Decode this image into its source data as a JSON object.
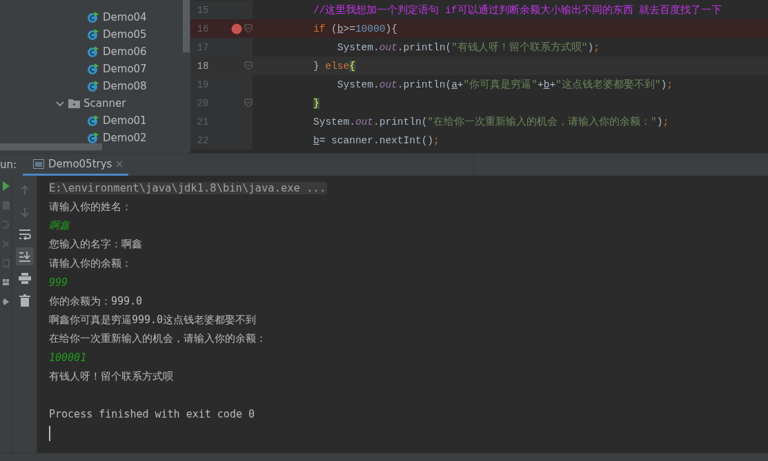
{
  "project_tree": [
    {
      "label": "Demo04",
      "kind": "class"
    },
    {
      "label": "Demo05",
      "kind": "class"
    },
    {
      "label": "Demo06",
      "kind": "class"
    },
    {
      "label": "Demo07",
      "kind": "class"
    },
    {
      "label": "Demo08",
      "kind": "class"
    },
    {
      "label": "Scanner",
      "kind": "package",
      "expanded": true,
      "children": [
        {
          "label": "Demo01",
          "kind": "class"
        },
        {
          "label": "Demo02",
          "kind": "class"
        }
      ]
    }
  ],
  "editor": {
    "lines": [
      {
        "number": "15",
        "breakpoint": false,
        "current": false,
        "fold": false,
        "tokens": [
          {
            "text": "//这里我想加一个判定语句 if可以通过判断余额大小输出不同的东西 就去百度找了一下",
            "kind": "comment"
          }
        ]
      },
      {
        "number": "16",
        "breakpoint": true,
        "current": false,
        "fold": true,
        "tokens": [
          {
            "text": "if",
            "kind": "keyword"
          },
          {
            "text": " (",
            "kind": "plain"
          },
          {
            "text": "b",
            "kind": "var"
          },
          {
            "text": ">=",
            "kind": "plain"
          },
          {
            "text": "10000",
            "kind": "number"
          },
          {
            "text": "){",
            "kind": "plain"
          }
        ]
      },
      {
        "number": "17",
        "breakpoint": false,
        "current": false,
        "fold": false,
        "tokens": [
          {
            "text": "    System.",
            "kind": "plain"
          },
          {
            "text": "out",
            "kind": "field"
          },
          {
            "text": ".println(",
            "kind": "plain"
          },
          {
            "text": "\"有钱人呀！留个联系方式呗\"",
            "kind": "string"
          },
          {
            "text": ")",
            "kind": "plain"
          },
          {
            "text": ";",
            "kind": "semicolon"
          }
        ]
      },
      {
        "number": "18",
        "breakpoint": false,
        "current": true,
        "fold": true,
        "tokens": [
          {
            "text": "} ",
            "kind": "plain"
          },
          {
            "text": "else",
            "kind": "keyword"
          },
          {
            "text": "{",
            "kind": "brace"
          }
        ]
      },
      {
        "number": "19",
        "breakpoint": false,
        "current": false,
        "fold": false,
        "tokens": [
          {
            "text": "    System.",
            "kind": "plain"
          },
          {
            "text": "out",
            "kind": "field"
          },
          {
            "text": ".println(",
            "kind": "plain"
          },
          {
            "text": "a",
            "kind": "var"
          },
          {
            "text": "+",
            "kind": "plain"
          },
          {
            "text": "\"你可真是穷逼\"",
            "kind": "string"
          },
          {
            "text": "+",
            "kind": "plain"
          },
          {
            "text": "b",
            "kind": "var"
          },
          {
            "text": "+",
            "kind": "plain"
          },
          {
            "text": "\"这点钱老婆都娶不到\"",
            "kind": "string"
          },
          {
            "text": ")",
            "kind": "plain"
          },
          {
            "text": ";",
            "kind": "semicolon"
          }
        ]
      },
      {
        "number": "20",
        "breakpoint": false,
        "current": false,
        "fold": true,
        "tokens": [
          {
            "text": "}",
            "kind": "brace"
          }
        ]
      },
      {
        "number": "21",
        "breakpoint": false,
        "current": false,
        "fold": false,
        "tokens": [
          {
            "text": "System.",
            "kind": "plain"
          },
          {
            "text": "out",
            "kind": "field"
          },
          {
            "text": ".println(",
            "kind": "plain"
          },
          {
            "text": "\"在给你一次重新输入的机会，请输入你的余额：\"",
            "kind": "string"
          },
          {
            "text": ")",
            "kind": "plain"
          },
          {
            "text": ";",
            "kind": "semicolon"
          }
        ]
      },
      {
        "number": "22",
        "breakpoint": false,
        "current": false,
        "fold": false,
        "tokens": [
          {
            "text": "b",
            "kind": "var"
          },
          {
            "text": "= scanner.nextInt()",
            "kind": "plain"
          },
          {
            "text": ";",
            "kind": "semicolon"
          }
        ]
      }
    ]
  },
  "run_panel": {
    "label": "un:",
    "tabs": [
      {
        "label": "Demo05trys",
        "selected": true
      }
    ],
    "scroll_to_end": true,
    "console": [
      {
        "text": "E:\\environment\\java\\jdk1.8\\bin\\java.exe ...",
        "kind": "command"
      },
      {
        "text": "请输入你的姓名：",
        "kind": "output"
      },
      {
        "text": "啊鑫",
        "kind": "input"
      },
      {
        "text": "您输入的名字：啊鑫",
        "kind": "output"
      },
      {
        "text": "请输入你的余额：",
        "kind": "output"
      },
      {
        "text": "999",
        "kind": "input"
      },
      {
        "text": "你的余额为：999.0",
        "kind": "output"
      },
      {
        "text": "啊鑫你可真是穷逼999.0这点钱老婆都娶不到",
        "kind": "output"
      },
      {
        "text": "在给你一次重新输入的机会，请输入你的余额：",
        "kind": "output"
      },
      {
        "text": "100001",
        "kind": "input"
      },
      {
        "text": "有钱人呀！留个联系方式呗",
        "kind": "output"
      },
      {
        "kind": "blank"
      },
      {
        "text": "Process finished with exit code 0",
        "kind": "output"
      },
      {
        "kind": "cursor"
      }
    ]
  }
}
